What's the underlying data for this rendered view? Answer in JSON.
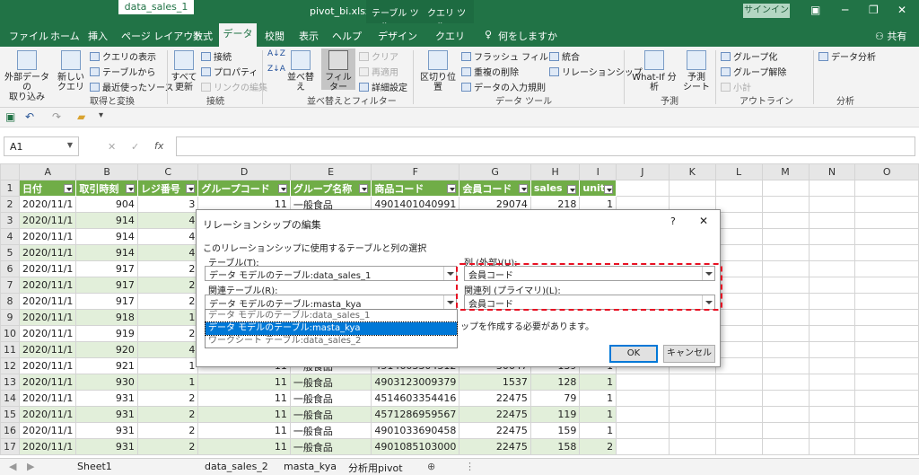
{
  "titlebar": {
    "title": "pivot_bi.xlsx  -  Excel",
    "context_tab1": "テーブル ツール",
    "context_tab2": "クエリ ツール",
    "signin": "サインイン"
  },
  "tabs": [
    "ファイル",
    "ホーム",
    "挿入",
    "ページ レイアウト",
    "数式",
    "データ",
    "校閲",
    "表示",
    "ヘルプ",
    "デザイン",
    "クエリ",
    "何をしますか",
    "共有"
  ],
  "ribbon": {
    "ext_data": "外部データの\n取り込み",
    "new_query": "新しい\nクエリ",
    "show_queries": "クエリの表示",
    "from_table": "テーブルから",
    "recent_sources": "最近使ったソース",
    "group_get": "取得と変換",
    "refresh_all": "すべて\n更新",
    "connections": "接続",
    "properties": "プロパティ",
    "edit_links": "リンクの編集",
    "group_conn": "接続",
    "sort": "並べ替え",
    "filter": "フィルター",
    "clear": "クリア",
    "reapply": "再適用",
    "advanced": "詳細設定",
    "group_sort": "並べ替えとフィルター",
    "text_to_cols": "区切り位置",
    "flash_fill": "フラッシュ フィル",
    "remove_dup": "重複の削除",
    "data_valid": "データの入力規則",
    "consolidate": "統合",
    "relationships": "リレーションシップ",
    "group_tools": "データ ツール",
    "whatif": "What-If 分析",
    "forecast_sheet": "予測\nシート",
    "group_forecast": "予測",
    "group_btn": "グループ化",
    "ungroup": "グループ解除",
    "subtotal": "小計",
    "group_outline": "アウトライン",
    "data_analysis": "データ分析",
    "group_analysis": "分析"
  },
  "namebox": "A1",
  "fx_label": "fx",
  "columns": [
    "A",
    "B",
    "C",
    "D",
    "E",
    "F",
    "G",
    "H",
    "I",
    "J",
    "K",
    "L",
    "M",
    "N",
    "O"
  ],
  "headers": [
    "日付",
    "取引時刻",
    "レジ番号",
    "グループコード",
    "グループ名称",
    "商品コード",
    "会員コード",
    "sales",
    "unit"
  ],
  "rows": [
    [
      "2020/11/1",
      "904",
      "3",
      "11",
      "一般食品",
      "4901401040991",
      "29074",
      "218",
      "1"
    ],
    [
      "2020/11/1",
      "914",
      "4",
      "",
      "",
      "",
      "",
      "",
      ""
    ],
    [
      "2020/11/1",
      "914",
      "4",
      "",
      "",
      "",
      "",
      "",
      ""
    ],
    [
      "2020/11/1",
      "914",
      "4",
      "",
      "",
      "",
      "",
      "",
      ""
    ],
    [
      "2020/11/1",
      "917",
      "2",
      "",
      "",
      "",
      "",
      "",
      ""
    ],
    [
      "2020/11/1",
      "917",
      "2",
      "",
      "",
      "",
      "",
      "",
      ""
    ],
    [
      "2020/11/1",
      "917",
      "2",
      "",
      "",
      "",
      "",
      "",
      ""
    ],
    [
      "2020/11/1",
      "918",
      "1",
      "",
      "",
      "",
      "",
      "",
      ""
    ],
    [
      "2020/11/1",
      "919",
      "2",
      "",
      "",
      "",
      "",
      "",
      ""
    ],
    [
      "2020/11/1",
      "920",
      "4",
      "",
      "",
      "",
      "",
      "",
      ""
    ],
    [
      "2020/11/1",
      "921",
      "1",
      "11",
      "一般食品",
      "4514603304312",
      "30647",
      "139",
      "1"
    ],
    [
      "2020/11/1",
      "930",
      "1",
      "11",
      "一般食品",
      "4903123009379",
      "1537",
      "128",
      "1"
    ],
    [
      "2020/11/1",
      "931",
      "2",
      "11",
      "一般食品",
      "4514603354416",
      "22475",
      "79",
      "1"
    ],
    [
      "2020/11/1",
      "931",
      "2",
      "11",
      "一般食品",
      "4571286959567",
      "22475",
      "119",
      "1"
    ],
    [
      "2020/11/1",
      "931",
      "2",
      "11",
      "一般食品",
      "4901033690458",
      "22475",
      "159",
      "1"
    ],
    [
      "2020/11/1",
      "931",
      "2",
      "11",
      "一般食品",
      "4901085103000",
      "22475",
      "158",
      "2"
    ]
  ],
  "sheet_tabs": [
    "Sheet1",
    "data_sales_1",
    "data_sales_2",
    "masta_kya",
    "分析用pivot"
  ],
  "dialog": {
    "title": "リレーションシップの編集",
    "help": "?",
    "close": "✕",
    "instruction": "このリレーションシップに使用するテーブルと列の選択",
    "table_label": "テーブル(T):",
    "table_value": "データ モデルのテーブル:data_sales_1",
    "related_label": "関連テーブル(R):",
    "related_value": "データ モデルのテーブル:masta_kya",
    "col_label": "列 (外部)(U):",
    "col_value": "会員コード",
    "pcol_label": "関連列 (プライマリ)(L):",
    "pcol_value": "会員コード",
    "note": "ップを作成する必要があります。",
    "ok": "OK",
    "cancel": "キャンセル",
    "options": [
      "データ モデルのテーブル:data_sales_1",
      "データ モデルのテーブル:masta_kya",
      "ワークシート テーブル:data_sales_2"
    ]
  },
  "colors": {
    "excel_green": "#217346",
    "table_header": "#70ad47",
    "table_band": "#e2efda",
    "highlight": "#e81123",
    "selection": "#0078d7"
  }
}
